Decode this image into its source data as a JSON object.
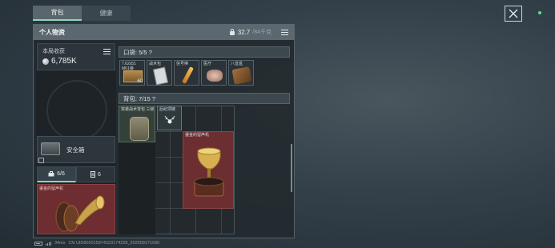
{
  "tabs": [
    {
      "label": "背包",
      "active": true
    },
    {
      "label": "健康",
      "active": false
    }
  ],
  "panel": {
    "title": "个人物资",
    "weight_current": "32.7",
    "weight_capacity": "/84千克"
  },
  "earnings": {
    "label": "本局收获",
    "value": "6,785K"
  },
  "safe_box": {
    "label": "安全箱"
  },
  "counters": [
    {
      "icon": "briefcase-icon",
      "value": "6/6"
    },
    {
      "icon": "document-icon",
      "value": "6"
    }
  ],
  "safe_item": {
    "name": "鎏金的留声机"
  },
  "pocket": {
    "header": "口袋: 5/5",
    "help": "?",
    "items": [
      {
        "name": "7.62x51 M61弹",
        "qty": "60",
        "icon": "ammo-box-icon"
      },
      {
        "name": "战术包",
        "qty": "",
        "icon": "pouch-icon"
      },
      {
        "name": "信号棒",
        "qty": "",
        "icon": "flare-stick-icon"
      },
      {
        "name": "医疗",
        "qty": "",
        "icon": "medical-icon"
      },
      {
        "name": "八音盒",
        "qty": "",
        "icon": "music-box-icon"
      }
    ]
  },
  "bag": {
    "header": "背包: 7/15",
    "help": "?",
    "items": [
      {
        "name": "突袭战术背包 三级",
        "icon": "tactical-backpack-icon"
      },
      {
        "name": "后纪项链",
        "icon": "necklace-icon"
      },
      {
        "name": "鎏金的留声机",
        "icon": "gramophone-icon"
      }
    ]
  },
  "status": {
    "ping": "34ms",
    "build": "CN UID802015974323174228_202509271930"
  },
  "colors": {
    "accent": "#8fd5b8",
    "rare_red": "#6d2e31",
    "panel_header": "#5c6870"
  }
}
